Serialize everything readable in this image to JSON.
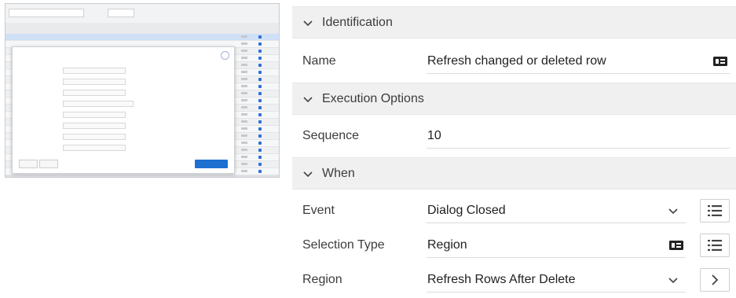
{
  "panel": {
    "sections": {
      "identification": {
        "title": "Identification"
      },
      "execution": {
        "title": "Execution Options"
      },
      "when": {
        "title": "When"
      }
    },
    "rows": {
      "name": {
        "label": "Name",
        "value": "Refresh changed or deleted row"
      },
      "sequence": {
        "label": "Sequence",
        "value": "10"
      },
      "event": {
        "label": "Event",
        "value": "Dialog Closed"
      },
      "selection_type": {
        "label": "Selection Type",
        "value": "Region"
      },
      "region": {
        "label": "Region",
        "value": "Refresh Rows After Delete"
      }
    }
  },
  "icons": {
    "section_toggle": "chevron-down-icon",
    "quick_pick": "quick-pick-icon",
    "list": "list-icon",
    "go": "chevron-right-icon"
  }
}
